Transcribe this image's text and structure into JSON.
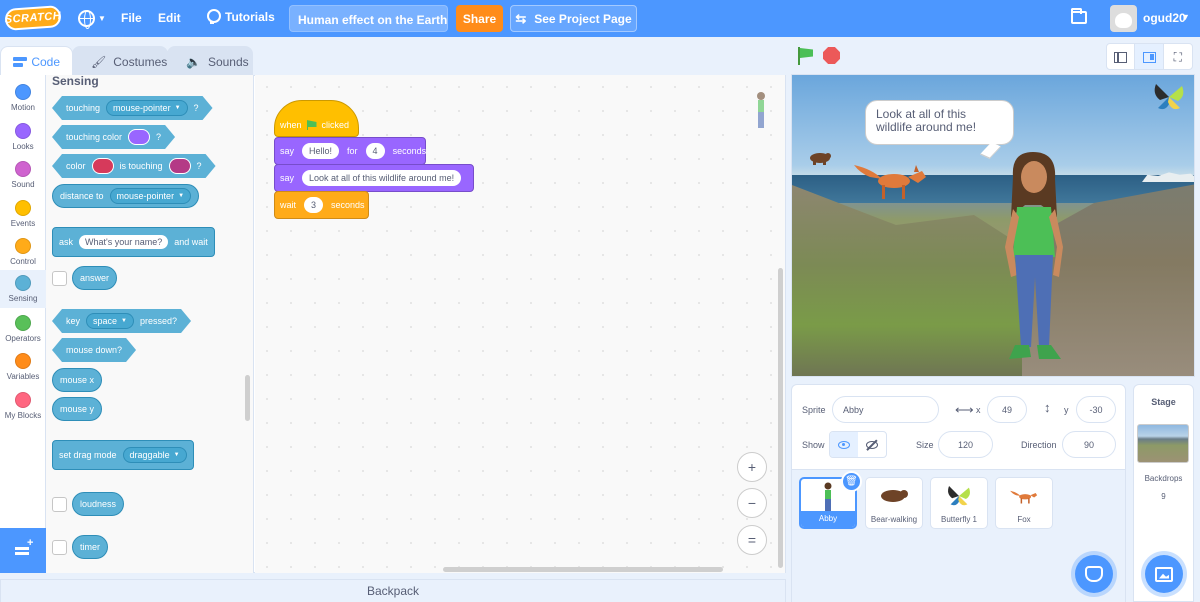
{
  "menubar": {
    "logo": "SCRATCH",
    "file": "File",
    "edit": "Edit",
    "tutorials": "Tutorials",
    "project_title": "Human effect on the Earth",
    "share": "Share",
    "see_project_page": "See Project Page",
    "username": "ogud20"
  },
  "tabs": {
    "code": "Code",
    "costumes": "Costumes",
    "sounds": "Sounds"
  },
  "categories": [
    {
      "label": "Motion",
      "color": "#4c97ff"
    },
    {
      "label": "Looks",
      "color": "#9966ff"
    },
    {
      "label": "Sound",
      "color": "#cf63cf"
    },
    {
      "label": "Events",
      "color": "#ffbf00"
    },
    {
      "label": "Control",
      "color": "#ffab19"
    },
    {
      "label": "Sensing",
      "color": "#5cb1d6"
    },
    {
      "label": "Operators",
      "color": "#59c059"
    },
    {
      "label": "Variables",
      "color": "#ff8c1a"
    },
    {
      "label": "My Blocks",
      "color": "#ff6680"
    }
  ],
  "palette": {
    "title": "Sensing",
    "touching": "touching",
    "mouse_pointer": "mouse-pointer",
    "q": "?",
    "touching_color": "touching color",
    "color": "color",
    "is_touching": "is touching",
    "distance_to": "distance to",
    "ask": "ask",
    "ask_default": "What's your name?",
    "and_wait": "and wait",
    "answer": "answer",
    "key": "key",
    "space": "space",
    "pressed": "pressed?",
    "mouse_down": "mouse down?",
    "mouse_x": "mouse x",
    "mouse_y": "mouse y",
    "set_drag_mode": "set drag mode",
    "draggable": "draggable",
    "loudness": "loudness",
    "timer": "timer",
    "swatch_colors": {
      "a": "#9966ff",
      "b": "#d63a5b",
      "c": "#b43a86"
    }
  },
  "script": {
    "when": "when",
    "clicked": "clicked",
    "say1": "say",
    "say1_text": "Hello!",
    "for": "for",
    "say1_secs": "4",
    "seconds": "seconds",
    "say2": "say",
    "say2_text": "Look at all of this wildlife around me!",
    "wait": "wait",
    "wait_secs": "3",
    "seconds2": "seconds"
  },
  "zoom": {
    "in": "+",
    "out": "−",
    "reset": "="
  },
  "backpack": "Backpack",
  "stage": {
    "speech": "Look at all of this wildlife around me!"
  },
  "sprite_info": {
    "sprite_label": "Sprite",
    "sprite_name": "Abby",
    "x_label": "x",
    "x_value": "49",
    "y_label": "y",
    "y_value": "-30",
    "show_label": "Show",
    "size_label": "Size",
    "size_value": "120",
    "direction_label": "Direction",
    "direction_value": "90"
  },
  "sprites": [
    {
      "name": "Abby"
    },
    {
      "name": "Bear-walking"
    },
    {
      "name": "Butterfly 1"
    },
    {
      "name": "Fox"
    }
  ],
  "stage_pane": {
    "title": "Stage",
    "backdrops_label": "Backdrops",
    "backdrops_count": "9"
  }
}
